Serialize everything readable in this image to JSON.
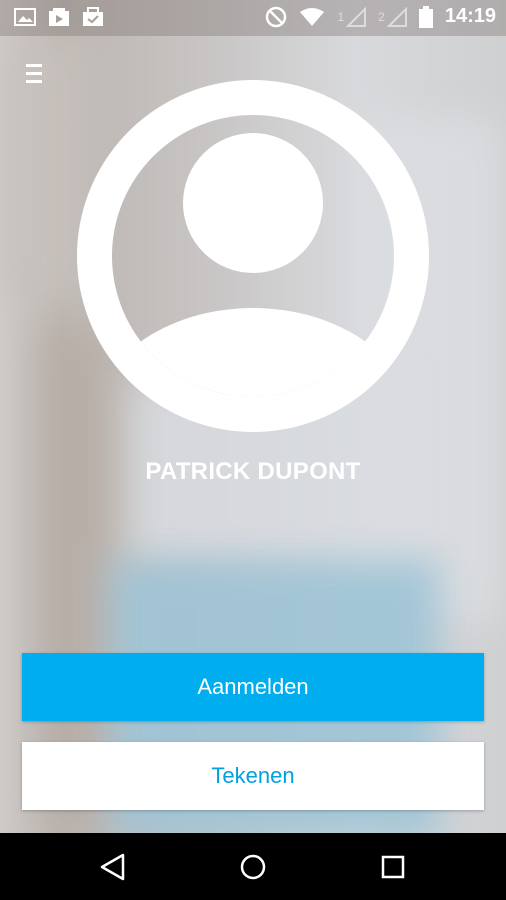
{
  "status_bar": {
    "time": "14:19",
    "sim1": "1",
    "sim2": "2",
    "icons": [
      "gallery-icon",
      "video-icon",
      "shopping-bag-icon",
      "do-not-disturb-icon",
      "wifi-icon",
      "signal-icon",
      "battery-icon"
    ]
  },
  "header": {
    "menu_icon": "hamburger-menu-icon"
  },
  "profile": {
    "avatar_icon": "user-avatar-icon",
    "name": "PATRICK DUPONT"
  },
  "actions": {
    "login_label": "Aanmelden",
    "signup_label": "Tekenen",
    "primary_color": "#00adee",
    "secondary_text_color": "#00a1e0"
  },
  "nav": {
    "icons": [
      "back-icon",
      "home-icon",
      "recent-apps-icon"
    ]
  }
}
